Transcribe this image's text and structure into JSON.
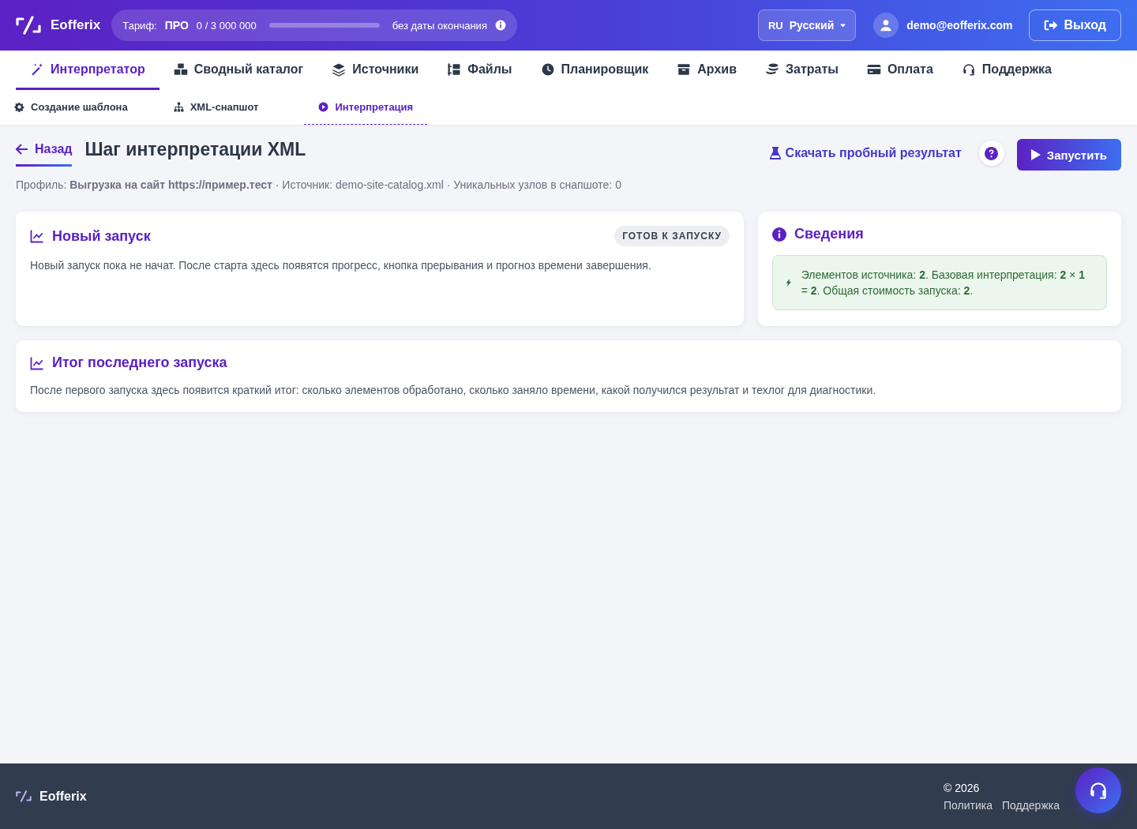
{
  "header": {
    "brand": "Eofferix",
    "plan": {
      "label": "Тариф:",
      "name": "ПРО",
      "usage": "0 / 3 000 000",
      "level": 0,
      "expiry": "без даты окончания"
    },
    "language": {
      "code": "RU",
      "name": "Русский"
    },
    "user_email": "demo@eofferix.com",
    "logout": "Выход"
  },
  "tabs": [
    {
      "label": "Интерпретатор",
      "selected": true
    },
    {
      "label": "Сводный каталог",
      "selected": false
    },
    {
      "label": "Источники",
      "selected": false
    },
    {
      "label": "Файлы",
      "selected": false
    },
    {
      "label": "Планировщик",
      "selected": false
    },
    {
      "label": "Архив",
      "selected": false
    },
    {
      "label": "Затраты",
      "selected": false
    },
    {
      "label": "Оплата",
      "selected": false
    },
    {
      "label": "Поддержка",
      "selected": false
    }
  ],
  "subtabs": [
    {
      "label": "Создание шаблона",
      "selected": false
    },
    {
      "label": "XML-снапшот",
      "selected": false
    },
    {
      "label": "Интерпретация",
      "selected": true
    }
  ],
  "page": {
    "back": "Назад",
    "title": "Шаг интерпретации XML",
    "download": "Скачать пробный результат",
    "run": "Запустить",
    "meta": "Профиль: **Выгрузка на сайт https://пример.тест** · Источник: demo-site-catalog.xml · Уникальных узлов в снапшоте: 0"
  },
  "new_run": {
    "title": "Новый запуск",
    "status": "ГОТОВ К ЗАПУСКУ",
    "text": "Новый запуск пока не начат. После старта здесь появятся прогресс, кнопка прерывания и прогноз времени завершения."
  },
  "info": {
    "title": "Сведения",
    "note": "Элементов источника: **2**. Базовая интерпретация: **2** × **1** = **2**. Общая стоимость запуска: **2**."
  },
  "last_run": {
    "title": "Итог последнего запуска",
    "text": "После первого запуска здесь появится краткий итог: сколько элементов обработано, сколько заняло времени, какой получился результат и техлог для диагностики."
  },
  "footer": {
    "brand": "Eofferix",
    "copyright": "© 2026",
    "links": [
      "Политика",
      "Поддержка"
    ]
  }
}
